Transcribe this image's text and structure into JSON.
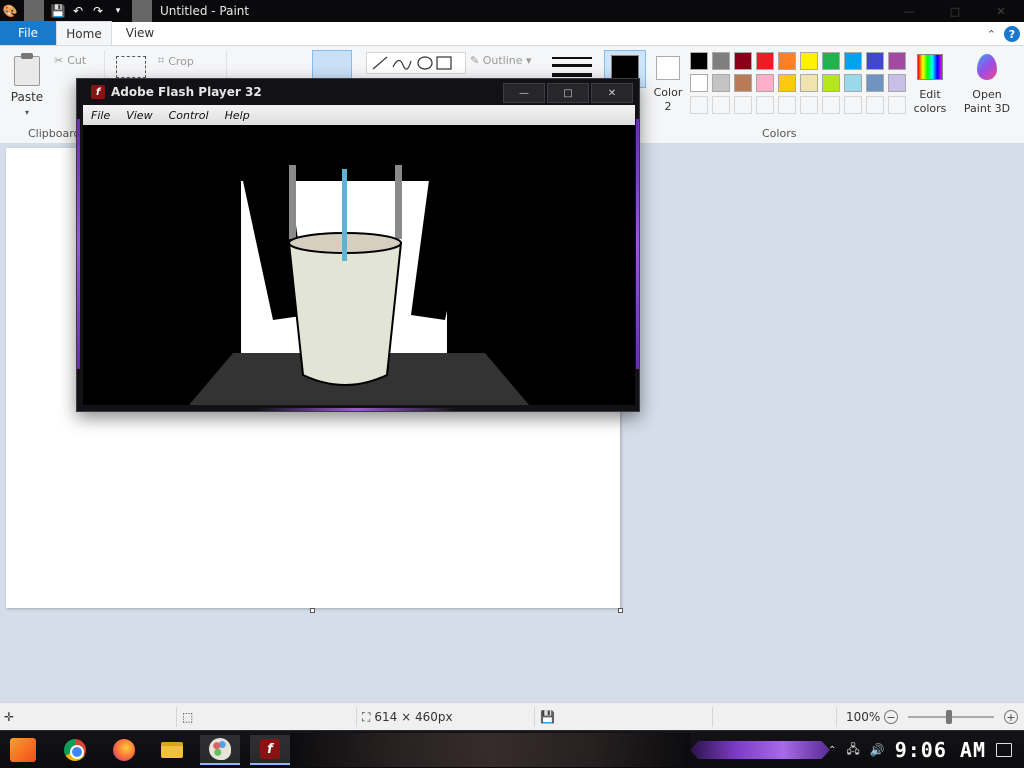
{
  "paint": {
    "title": "Untitled - Paint",
    "tabs": [
      "File",
      "Home",
      "View"
    ],
    "clipboard": {
      "paste": "Paste",
      "cut": "Cut",
      "group": "Clipboard"
    },
    "image": {
      "crop": "Crop"
    },
    "shapes": {
      "outline": "Outline"
    },
    "colors": {
      "color2": "Color 2",
      "edit": "Edit colors",
      "open3d": "Open Paint 3D",
      "group": "Colors",
      "palette_row1": [
        "#000000",
        "#7f7f7f",
        "#880015",
        "#ed1c24",
        "#ff7f27",
        "#fff200",
        "#22b14c",
        "#00a2e8",
        "#3f48cc",
        "#a349a4"
      ],
      "palette_row2": [
        "#ffffff",
        "#c3c3c3",
        "#b97a57",
        "#ffaec9",
        "#ffc90e",
        "#efe4b0",
        "#b5e61d",
        "#99d9ea",
        "#7092be",
        "#c8bfe7"
      ]
    },
    "status": {
      "size": "614 × 460px",
      "zoom": "100%"
    }
  },
  "flash": {
    "title": "Adobe Flash Player 32",
    "menu": [
      "File",
      "View",
      "Control",
      "Help"
    ],
    "logo_letter": "f"
  },
  "taskbar": {
    "clock": "9:06 AM"
  },
  "accent": {
    "file_tab": "#1979ca",
    "flash_red": "#8b1212",
    "purple": "#9b59d6"
  }
}
